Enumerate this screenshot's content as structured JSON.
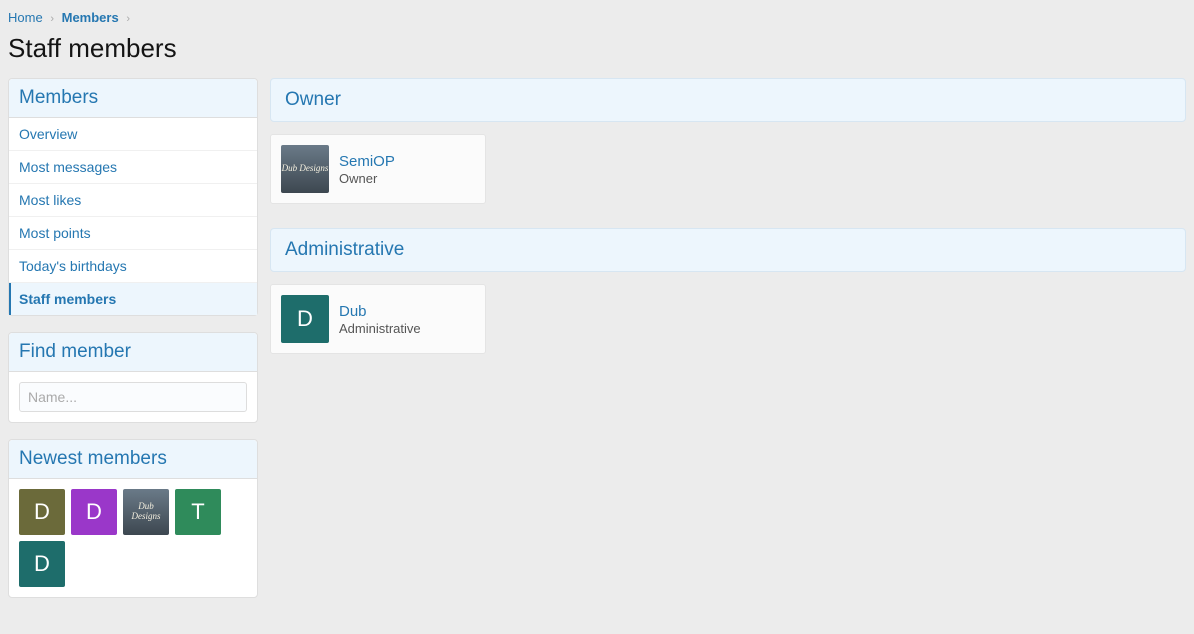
{
  "breadcrumb": {
    "home": "Home",
    "members": "Members"
  },
  "page_title": "Staff members",
  "sidebar": {
    "members_block": {
      "title": "Members",
      "items": [
        {
          "label": "Overview"
        },
        {
          "label": "Most messages"
        },
        {
          "label": "Most likes"
        },
        {
          "label": "Most points"
        },
        {
          "label": "Today's birthdays"
        },
        {
          "label": "Staff members"
        }
      ]
    },
    "find_block": {
      "title": "Find member",
      "placeholder": "Name..."
    },
    "newest_block": {
      "title": "Newest members",
      "avatars": [
        {
          "letter": "D",
          "bg": "#6b6a3a"
        },
        {
          "letter": "D",
          "bg": "#9a37c9"
        },
        {
          "letter": "",
          "bg": "img",
          "text": "Dub Designs"
        },
        {
          "letter": "T",
          "bg": "#2f8b5b"
        },
        {
          "letter": "D",
          "bg": "#1e6d6b"
        }
      ]
    }
  },
  "sections": [
    {
      "title": "Owner",
      "members": [
        {
          "name": "SemiOP",
          "role": "Owner",
          "avatar_type": "img",
          "avatar_text": "Dub Designs",
          "avatar_bg": ""
        }
      ]
    },
    {
      "title": "Administrative",
      "members": [
        {
          "name": "Dub",
          "role": "Administrative",
          "avatar_type": "letter",
          "avatar_text": "D",
          "avatar_bg": "#1e6d6b"
        }
      ]
    }
  ]
}
